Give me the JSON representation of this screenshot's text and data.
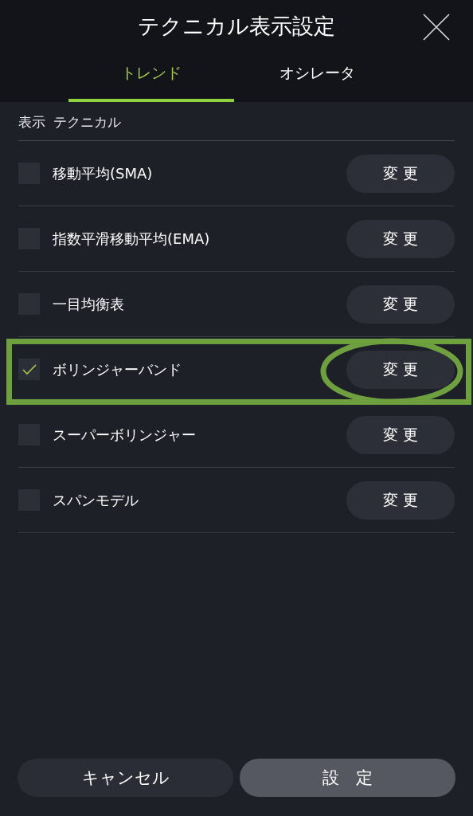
{
  "header": {
    "title": "テクニカル表示設定"
  },
  "tabs": [
    {
      "label": "トレンド",
      "selected": true
    },
    {
      "label": "オシレータ",
      "selected": false
    }
  ],
  "list_header": {
    "column_1": "表示",
    "column_2": "テクニカル"
  },
  "rows": [
    {
      "name": "移動平均(SMA)",
      "checked": false,
      "button": "変 更",
      "highlighted": false
    },
    {
      "name": "指数平滑移動平均(EMA)",
      "checked": false,
      "button": "変 更",
      "highlighted": false
    },
    {
      "name": "一目均衡表",
      "checked": false,
      "button": "変 更",
      "highlighted": false
    },
    {
      "name": "ボリンジャーバンド",
      "checked": true,
      "button": "変 更",
      "highlighted": true
    },
    {
      "name": "スーパーボリンジャー",
      "checked": false,
      "button": "変 更",
      "highlighted": false
    },
    {
      "name": "スパンモデル",
      "checked": false,
      "button": "変 更",
      "highlighted": false
    }
  ],
  "footer": {
    "cancel": "キャンセル",
    "confirm": "設　定"
  }
}
